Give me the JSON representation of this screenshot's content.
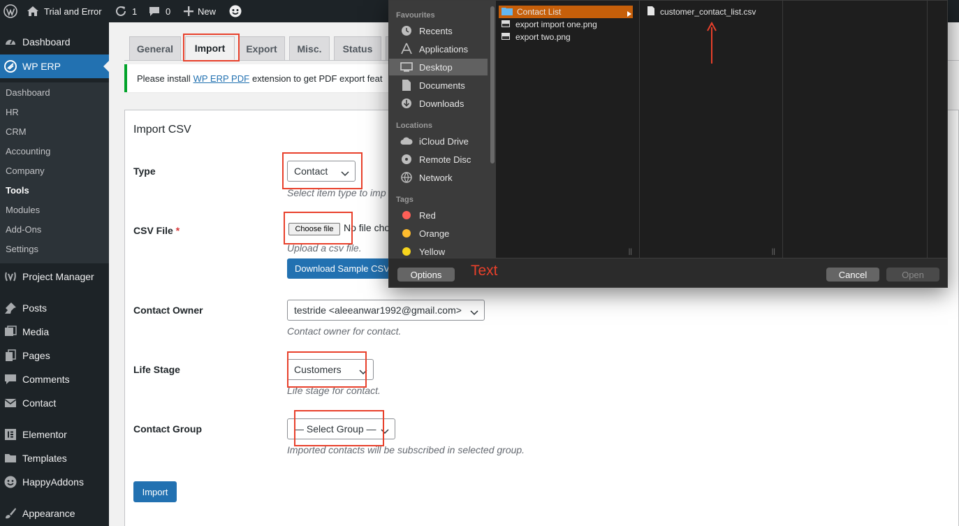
{
  "adminbar": {
    "site_name": "Trial and Error",
    "updates_count": "1",
    "comments_count": "0",
    "new_label": "New"
  },
  "sidebar": {
    "top_items": [
      {
        "label": "Dashboard",
        "icon": "dashboard-icon"
      },
      {
        "label": "WP ERP",
        "icon": "erp-icon"
      },
      {
        "label": "Project Manager",
        "icon": "project-manager-icon"
      },
      {
        "label": "Posts",
        "icon": "pin-icon"
      },
      {
        "label": "Media",
        "icon": "media-icon"
      },
      {
        "label": "Pages",
        "icon": "pages-icon"
      },
      {
        "label": "Comments",
        "icon": "comments-icon"
      },
      {
        "label": "Contact",
        "icon": "mail-icon"
      },
      {
        "label": "Elementor",
        "icon": "elementor-icon"
      },
      {
        "label": "Templates",
        "icon": "folder-icon"
      },
      {
        "label": "HappyAddons",
        "icon": "happyaddons-icon"
      },
      {
        "label": "Appearance",
        "icon": "brush-icon"
      }
    ],
    "submenu": [
      "Dashboard",
      "HR",
      "CRM",
      "Accounting",
      "Company",
      "Tools",
      "Modules",
      "Add-Ons",
      "Settings"
    ],
    "current_submenu": "Tools"
  },
  "tabs": [
    "General",
    "Import",
    "Export",
    "Misc.",
    "Status"
  ],
  "active_tab": "Import",
  "notice": {
    "before": "Please install",
    "link": "WP ERP PDF",
    "after": "extension to get PDF export feat"
  },
  "form": {
    "heading": "Import CSV",
    "type_label": "Type",
    "type_value": "Contact",
    "type_desc": "Select item type to imp",
    "csv_label": "CSV File",
    "required_mark": "*",
    "choose_file": "Choose file",
    "no_file": "No file cho",
    "csv_desc": "Upload a csv file.",
    "download_sample": "Download Sample CSV",
    "owner_label": "Contact Owner",
    "owner_value": "testride <aleeanwar1992@gmail.com>",
    "owner_desc": "Contact owner for contact.",
    "stage_label": "Life Stage",
    "stage_value": "Customers",
    "stage_desc": "Life stage for contact.",
    "group_label": "Contact Group",
    "group_value": "— Select Group —",
    "group_desc": "Imported contacts will be subscribed in selected group.",
    "import_button": "Import"
  },
  "dialog": {
    "favourites_heading": "Favourites",
    "favourites": [
      {
        "label": "Recents",
        "icon": "clock-icon"
      },
      {
        "label": "Applications",
        "icon": "applications-icon"
      },
      {
        "label": "Desktop",
        "icon": "desktop-icon"
      },
      {
        "label": "Documents",
        "icon": "document-icon"
      },
      {
        "label": "Downloads",
        "icon": "download-icon"
      }
    ],
    "selected_favourite": "Desktop",
    "locations_heading": "Locations",
    "locations": [
      {
        "label": "iCloud Drive",
        "icon": "cloud-icon"
      },
      {
        "label": "Remote Disc",
        "icon": "disc-icon"
      },
      {
        "label": "Network",
        "icon": "network-icon"
      }
    ],
    "tags_heading": "Tags",
    "tags": [
      {
        "label": "Red",
        "color": "#ff5f57"
      },
      {
        "label": "Orange",
        "color": "#febc2e"
      },
      {
        "label": "Yellow",
        "color": "#f7d51d"
      }
    ],
    "column1": [
      "Contact List",
      "export import one.png",
      "export two.png"
    ],
    "column1_selected": "Contact List",
    "column2": [
      "customer_contact_list.csv"
    ],
    "options_button": "Options",
    "annotation_text": "Text",
    "cancel_button": "Cancel",
    "open_button": "Open"
  },
  "colors": {
    "wp_blue": "#2271b1",
    "admin_dark": "#1d2327",
    "annotation_red": "#e8402b",
    "finder_selection": "#c65f0a"
  }
}
